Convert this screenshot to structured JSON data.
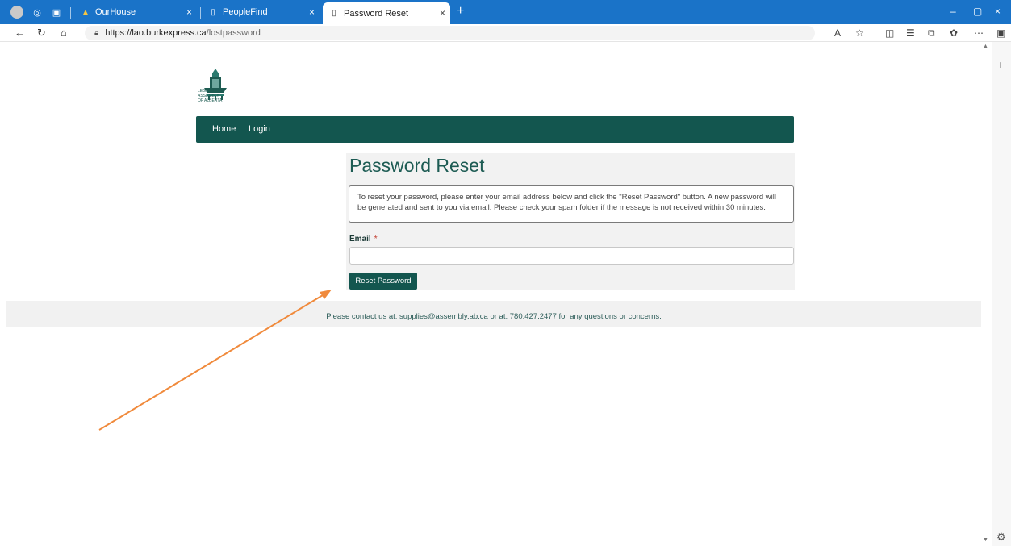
{
  "browser": {
    "tabs": [
      {
        "label": "OurHouse",
        "close": "×"
      },
      {
        "label": "PeopleFind",
        "close": "×"
      },
      {
        "label": "Password Reset",
        "close": "×"
      }
    ],
    "new_tab": "+",
    "window_controls": {
      "minimize": "–",
      "restore": "▢",
      "close": "×"
    },
    "url_host": "https://lao.burkexpress.ca",
    "url_path": "/lostpassword"
  },
  "site": {
    "logo_lines": [
      "LEGISLATIVE",
      "ASSEMBLY",
      "OF ALBERTA"
    ],
    "nav": {
      "home": "Home",
      "login": "Login"
    },
    "brand_color": "#13564f"
  },
  "form": {
    "title": "Password Reset",
    "info_text": "To reset your password, please enter your email address below and click the \"Reset Password\" button. A new password will be generated and sent to you via email. Please check your spam folder if the message is not received within 30 minutes.",
    "email_label": "Email",
    "required_marker": "*",
    "email_value": "",
    "reset_button": "Reset Password"
  },
  "footer": {
    "text": "Please contact us at: supplies@assembly.ab.ca or at: 780.427.2477 for any questions or concerns."
  },
  "annotation": {
    "arrow_color": "#f08a3c"
  }
}
